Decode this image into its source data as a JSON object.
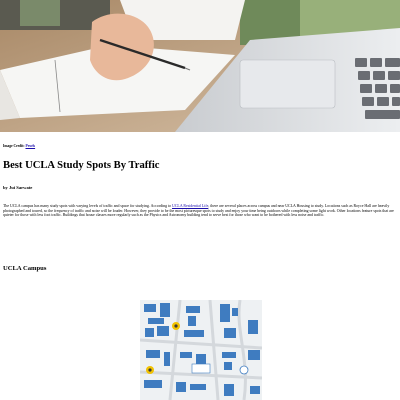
{
  "hero": {
    "image_alt": "student writing in a notebook next to a laptop"
  },
  "credit": {
    "label": "Image Credit:",
    "source": "Pexels"
  },
  "article": {
    "title": "Best UCLA Study Spots By Traffic",
    "byline": "by Jui Sarwate",
    "body_before_link": "The UCLA campus has many study spots with varying levels of traffic and space for studying. According to ",
    "link_text": "UCLA Residential Life",
    "body_after_link": ", there are several places across campus and near UCLA Housing to study. Locations such as Royce Hall are heavily photographed and toured, so the frequency of traffic and noise will be louder. However, they provide to be the most picturesque spots to study and enjoy your time being outdoors while completing some light work. Other locations feature spots that are quieter for those with less foot traffic. Buildings that house classes more regularly such as the Physics and Astronomy building tend to serve best for those who want to be bothered with less noise and traffic."
  },
  "section": {
    "heading": "UCLA Campus"
  },
  "map": {
    "image_alt": "UCLA campus map",
    "building_color": "#3f7cc0",
    "marker_color": "#f2c200"
  }
}
